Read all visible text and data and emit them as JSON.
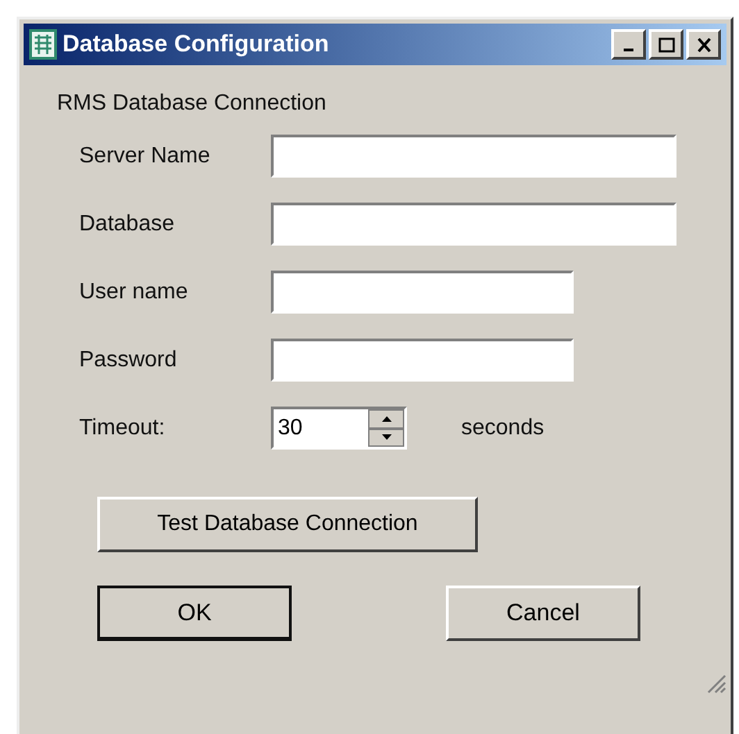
{
  "window": {
    "title": "Database Configuration"
  },
  "section_label": "RMS Database Connection",
  "fields": [
    {
      "kind": "text",
      "label": "Server Name",
      "wide": true
    },
    {
      "kind": "text",
      "label": "Database",
      "wide": true
    },
    {
      "kind": "text",
      "label": "User name",
      "wide": false
    },
    {
      "kind": "password",
      "label": "Password",
      "wide": false
    },
    {
      "kind": "spinner",
      "label": "Timeout:",
      "value": "30",
      "unit": "seconds"
    }
  ],
  "test_button": "Test Database Connection",
  "buttons": [
    {
      "label": "OK",
      "default": true
    },
    {
      "label": "Cancel",
      "default": false
    }
  ]
}
